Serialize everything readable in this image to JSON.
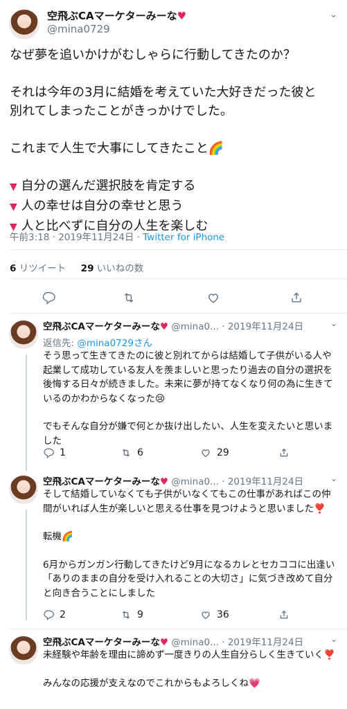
{
  "main_tweet": {
    "display_name": "空飛ぶCAマーケターみーな",
    "handle": "@mina0729",
    "body_lines": {
      "l1": "なぜ夢を追いかけがむしゃらに行動してきたのか？",
      "l2": "それは今年の3月に結婚を考えていた大好きだった彼と",
      "l3": "別れてしまったことがきっかけでした。",
      "l4": "これまで人生で大事にしてきたこと🌈",
      "l5": "自分の選んだ選択肢を肯定する",
      "l6": "人の幸せは自分の幸せと思う",
      "l7": "人と比べずに自分の人生を楽しむ"
    },
    "timestamp": "午前3:18 · 2019年11月24日 · ",
    "source": "Twitter for iPhone",
    "retweets_count": "6",
    "retweets_label": "リツイート",
    "likes_count": "29",
    "likes_label": "いいねの数"
  },
  "replies": [
    {
      "display_name": "空飛ぶCAマーケターみーな",
      "handle": "@mina0...",
      "date": " · 2019年11月24日",
      "reply_to_label": "返信先: ",
      "reply_to_handle": "@mina0729",
      "reply_to_suffix": "さん",
      "p1": "そう思って生きてきたのに彼と別れてからは結婚して子供がいる人や起業して成功している友人を羨ましいと思ったり過去の自分の選択を後悔する日々が続きました。未来に夢が持てなくなり何の為に生きているのかわからなくなった😢",
      "p2": "でもそんな自分が嫌で何とか抜け出したい、人生を変えたいと思いました",
      "replies_count": "1",
      "retweets_count": "6",
      "likes_count": "29"
    },
    {
      "display_name": "空飛ぶCAマーケターみーな",
      "handle": "@mina0...",
      "date": " · 2019年11月24日",
      "p1": "そして結婚していなくても子供がいなくてもこの仕事があればこの仲間がいれば人生が楽しいと思える仕事を見つけようと思いました❣️",
      "p2": "転機🌈",
      "p3": "6月からガンガン行動してきたけど9月になるカレとセカココに出逢い「ありのままの自分を受け入れることの大切さ」に気づき改めて自分と向き合うことにしました",
      "replies_count": "2",
      "retweets_count": "9",
      "likes_count": "36"
    },
    {
      "display_name": "空飛ぶCAマーケターみーな",
      "handle": "@mina0...",
      "date": " · 2019年11月24日",
      "p1": "未経験や年齢を理由に諦めず一度きりの人生自分らしく生きていく❣️",
      "p2": "みんなの応援が支えなのでこれからもよろしくね💗"
    }
  ],
  "icons": {
    "reply": "reply-icon",
    "retweet": "retweet-icon",
    "like": "like-icon",
    "share": "share-icon",
    "more": "chevron-down-icon"
  },
  "colors": {
    "accent": "#1b95e0",
    "muted": "#657786",
    "heart": "#e0245e"
  }
}
